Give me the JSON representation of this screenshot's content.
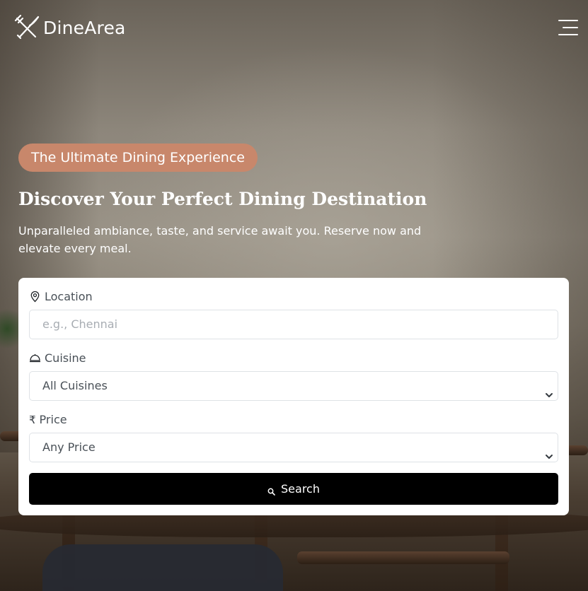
{
  "brand": {
    "name": "DineArea",
    "logo_icon": "fork-knife-icon"
  },
  "nav": {
    "menu_icon": "hamburger-menu-icon"
  },
  "hero": {
    "badge": "The Ultimate Dining Experience",
    "title": "Discover Your Perfect Dining Destination",
    "subtitle": "Unparalleled ambiance, taste, and service await you. Reserve now and elevate every meal."
  },
  "search_form": {
    "location": {
      "label": "Location",
      "icon": "map-pin-icon",
      "value": "",
      "placeholder": "e.g., Chennai"
    },
    "cuisine": {
      "label": "Cuisine",
      "icon": "food-cloche-icon",
      "selected": "All Cuisines"
    },
    "price": {
      "label": "Price",
      "icon": "₹",
      "selected": "Any Price"
    },
    "search_button": {
      "label": "Search",
      "icon": "search-icon"
    }
  },
  "colors": {
    "badge": "#c8876b",
    "button": "#000000",
    "card": "#ffffff"
  }
}
